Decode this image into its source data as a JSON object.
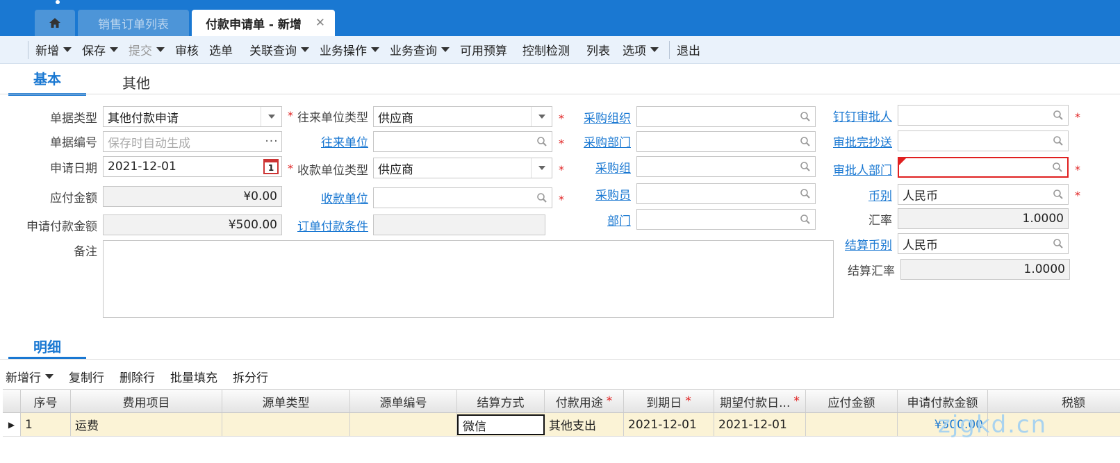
{
  "tabs": {
    "home_icon": "home-icon",
    "list_label": "销售订单列表",
    "current_label": "付款申请单 - 新增",
    "close_glyph": "✕"
  },
  "toolbar": {
    "new": "新增",
    "save": "保存",
    "submit": "提交",
    "audit": "审核",
    "select": "选单",
    "related_query": "关联查询",
    "business_op": "业务操作",
    "business_query": "业务查询",
    "available_budget": "可用预算",
    "control_check": "控制检测",
    "list": "列表",
    "options": "选项",
    "exit": "退出"
  },
  "section_tabs": {
    "basic": "基本",
    "other": "其他",
    "detail": "明细"
  },
  "form": {
    "doc_type": {
      "label": "单据类型",
      "value": "其他付款申请"
    },
    "doc_no": {
      "label": "单据编号",
      "placeholder": "保存时自动生成"
    },
    "apply_date": {
      "label": "申请日期",
      "value": "2021-12-01",
      "cal_day": "1"
    },
    "payable_amount": {
      "label": "应付金额",
      "value": "¥0.00"
    },
    "apply_pay_amount": {
      "label": "申请付款金额",
      "value": "¥500.00"
    },
    "remark": {
      "label": "备注",
      "value": ""
    },
    "partner_type": {
      "label": "往来单位类型",
      "value": "供应商"
    },
    "partner": {
      "label": "往来单位",
      "value": ""
    },
    "payee_type": {
      "label": "收款单位类型",
      "value": "供应商"
    },
    "payee": {
      "label": "收款单位",
      "value": ""
    },
    "order_pay_terms": {
      "label": "订单付款条件",
      "value": ""
    },
    "purchase_org": {
      "label": "采购组织",
      "value": ""
    },
    "purchase_dept": {
      "label": "采购部门",
      "value": ""
    },
    "purchase_group": {
      "label": "采购组",
      "value": ""
    },
    "purchaser": {
      "label": "采购员",
      "value": ""
    },
    "dept": {
      "label": "部门",
      "value": ""
    },
    "dingtalk_approver": {
      "label": "钉钉审批人",
      "value": ""
    },
    "approval_cc": {
      "label": "审批完抄送",
      "value": ""
    },
    "approver_dept": {
      "label": "审批人部门",
      "value": ""
    },
    "currency": {
      "label": "币别",
      "value": "人民币"
    },
    "exchange_rate": {
      "label": "汇率",
      "value": "1.0000"
    },
    "settle_currency": {
      "label": "结算币别",
      "value": "人民币"
    },
    "settle_rate": {
      "label": "结算汇率",
      "value": "1.0000"
    },
    "required_mark": "*"
  },
  "detail_toolbar": {
    "add_row": "新增行",
    "copy_row": "复制行",
    "delete_row": "删除行",
    "batch_fill": "批量填充",
    "split_row": "拆分行"
  },
  "grid": {
    "headers": {
      "seq": "序号",
      "expense_item": "费用项目",
      "src_type": "源单类型",
      "src_no": "源单编号",
      "settle_method": "结算方式",
      "pay_purpose": "付款用途",
      "due_date": "到期日",
      "expected_pay_date": "期望付款日...",
      "payable_amount": "应付金额",
      "apply_pay_amount": "申请付款金额",
      "tax": "税额"
    },
    "rows": [
      {
        "pointer": "▶",
        "seq": "1",
        "expense_item": "运费",
        "src_type": "",
        "src_no": "",
        "settle_method": "微信",
        "pay_purpose": "其他支出",
        "due_date": "2021-12-01",
        "expected_pay_date": "2021-12-01",
        "payable_amount": "",
        "apply_pay_amount": "¥500.00",
        "tax": ""
      }
    ]
  },
  "watermark": "zjgkd.cn",
  "colors": {
    "accent": "#1a78d2",
    "required": "#e02020",
    "row_highlight": "#fbf3d6"
  }
}
